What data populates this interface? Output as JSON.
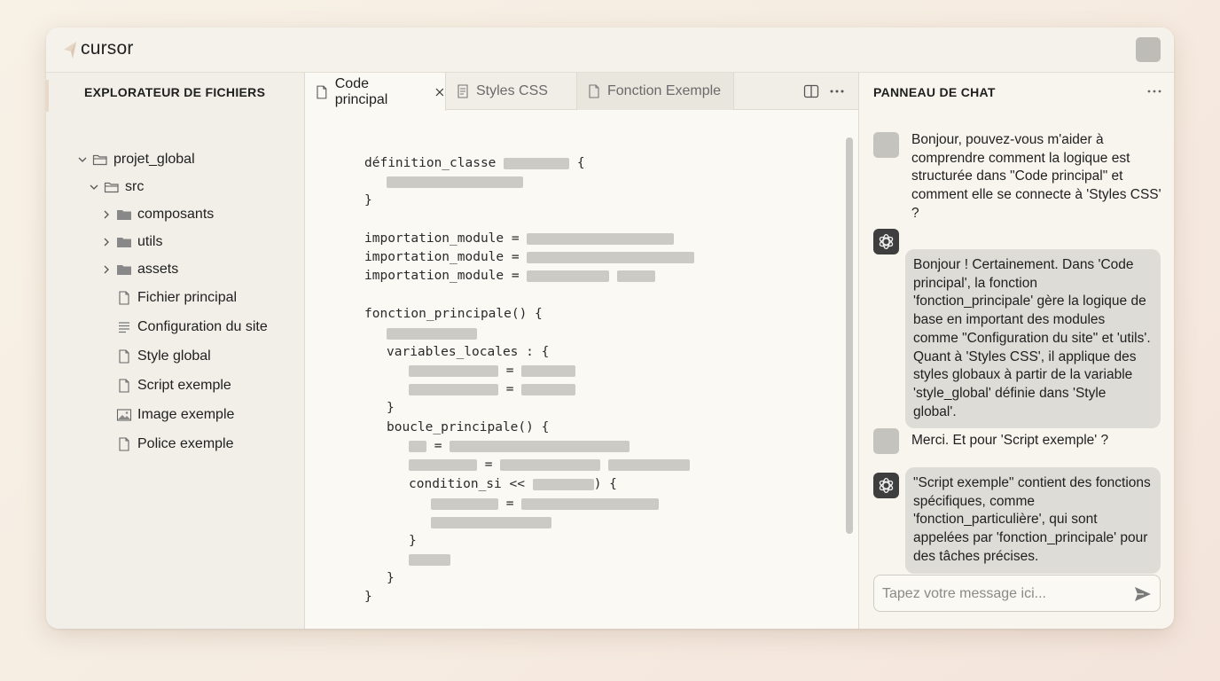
{
  "app": {
    "title": "cursor"
  },
  "sidebar": {
    "header": "EXPLORATEUR DE FICHIERS",
    "tree": [
      {
        "label": "projet_global",
        "icon": "folder-open-icon",
        "expanded": true
      },
      {
        "label": "src",
        "icon": "folder-open-icon",
        "expanded": true
      },
      {
        "label": "composants",
        "icon": "folder-icon",
        "expanded": false
      },
      {
        "label": "utils",
        "icon": "folder-icon",
        "expanded": false
      },
      {
        "label": "assets",
        "icon": "folder-icon",
        "expanded": false
      },
      {
        "label": "Fichier principal",
        "icon": "file-icon"
      },
      {
        "label": "Configuration du site",
        "icon": "lines-file-icon"
      },
      {
        "label": "Style global",
        "icon": "file-icon"
      },
      {
        "label": "Script exemple",
        "icon": "file-icon"
      },
      {
        "label": "Image exemple",
        "icon": "image-icon"
      },
      {
        "label": "Police exemple",
        "icon": "file-icon"
      }
    ]
  },
  "editor": {
    "tabs": [
      {
        "label": "Code principal",
        "active": true,
        "icon": "file-icon"
      },
      {
        "label": "Styles CSS",
        "active": false,
        "icon": "css-file-icon"
      },
      {
        "label": "Fonction Exemple",
        "active": false,
        "icon": "file-icon"
      }
    ],
    "code": {
      "class_def": "définition_classe",
      "brace_open": "{",
      "brace_close": "}",
      "import_kw": "importation_module =",
      "main_fn": "fonction_principale() {",
      "locals": "variables_locales : {",
      "eq": "=",
      "loop": "boucle_principale() {",
      "cond_a": "condition_si <<",
      "cond_b": ") {"
    }
  },
  "chat": {
    "header": "PANNEAU DE CHAT",
    "messages": [
      {
        "role": "user",
        "text": "Bonjour, pouvez-vous m'aider à comprendre comment la logique est structurée dans \"Code principal\" et comment elle se connecte à 'Styles CSS' ?"
      },
      {
        "role": "assistant",
        "text": "Bonjour ! Certainement. Dans 'Code principal', la fonction 'fonction_principale' gère la logique de base en important des modules comme \"Configuration du site\" et 'utils'. Quant à 'Styles CSS', il applique des styles globaux à partir de la variable 'style_global' définie dans 'Style global'."
      },
      {
        "role": "user",
        "text": "Merci. Et pour 'Script exemple' ?"
      },
      {
        "role": "assistant",
        "text": "\"Script exemple\" contient des fonctions spécifiques, comme 'fonction_particulière', qui sont appelées par 'fonction_principale' pour des tâches précises."
      }
    ],
    "input": {
      "placeholder": "Tapez votre message ici...",
      "value": ""
    }
  },
  "colors": {
    "accent": "#e8d9c8",
    "assistant_bubble": "#dedcd6",
    "placeholder_bar": "#cbcac5"
  }
}
